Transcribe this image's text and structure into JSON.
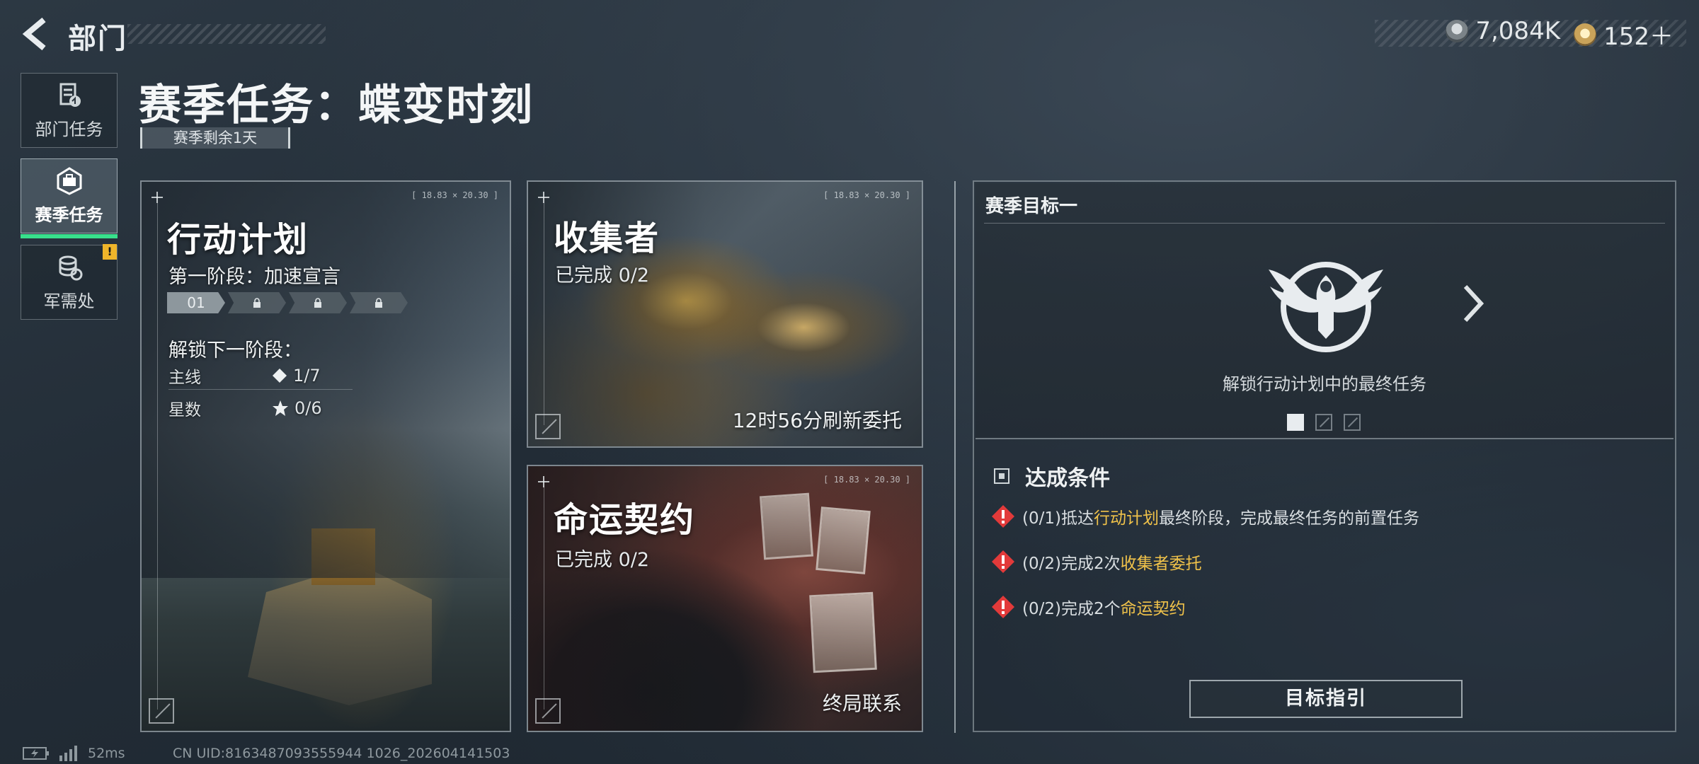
{
  "header": {
    "back_label": "部门",
    "currency_1": {
      "icon": "silver-coin-icon",
      "value": "7,084K"
    },
    "currency_2": {
      "icon": "gold-coin-icon",
      "value": "152＋"
    }
  },
  "sidebar": {
    "items": [
      {
        "label": "部门任务",
        "icon": "department-task-icon",
        "active": false
      },
      {
        "label": "赛季任务",
        "icon": "season-task-icon",
        "active": true
      },
      {
        "label": "军需处",
        "icon": "supply-coins-icon",
        "active": false,
        "badge": "!"
      }
    ]
  },
  "page": {
    "title": "赛季任务：蝶变时刻",
    "remaining": "赛季剩余1天"
  },
  "cards": {
    "action_plan": {
      "title": "行动计划",
      "coords": "[ 18.83 × 20.30 ]",
      "phase": "第一阶段：加速宣言",
      "stages": [
        "01",
        "",
        "",
        ""
      ],
      "unlock_title": "解锁下一阶段：",
      "requirements": [
        {
          "key": "主线",
          "icon": "diamond-icon",
          "value": "1/7"
        },
        {
          "key": "星数",
          "icon": "star-icon",
          "value": "0/6"
        }
      ]
    },
    "collector": {
      "title": "收集者",
      "coords": "[ 18.83 × 20.30 ]",
      "progress": "已完成 0/2",
      "footer": "12时56分刷新委托"
    },
    "fate_contract": {
      "title": "命运契约",
      "coords": "[ 18.83 × 20.30 ]",
      "progress": "已完成 0/2",
      "footer": "终局联系"
    }
  },
  "goal": {
    "title": "赛季目标一",
    "emblem": "eagle-emblem-icon",
    "description": "解锁行动计划中的最终任务",
    "page_current": 1,
    "page_total": 3,
    "conditions_title": "达成条件",
    "conditions": [
      {
        "prefix": "(0/1)抵达",
        "highlight": "行动计划",
        "suffix": "最终阶段，完成最终任务的前置任务"
      },
      {
        "prefix": "(0/2)完成2次",
        "highlight": "收集者委托",
        "suffix": ""
      },
      {
        "prefix": "(0/2)完成2个",
        "highlight": "命运契约",
        "suffix": ""
      }
    ],
    "guide_button": "目标指引"
  },
  "status": {
    "ping": "52ms",
    "uid": "CN UID:8163487093555944 1026_202604141503"
  },
  "colors": {
    "accent_green": "#38e08c",
    "highlight_gold": "#f0c24a",
    "warning_red": "#e23a3a",
    "badge_yellow": "#f0b52a"
  }
}
